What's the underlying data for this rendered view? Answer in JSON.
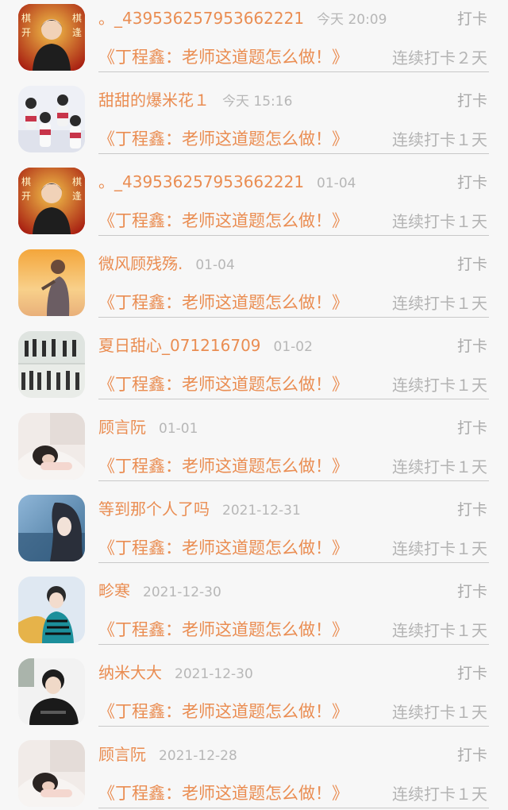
{
  "items": [
    {
      "name": "。_439536257953662221",
      "time": "今天 20:09",
      "action": "打卡",
      "title": "《丁程鑫：老师这道题怎么做！》",
      "streak": "连续打卡２天",
      "avatar": "game-poster-avatar"
    },
    {
      "name": "甜甜的爆米花１",
      "time": "今天 15:16",
      "action": "打卡",
      "title": "《丁程鑫：老师这道题怎么做！》",
      "streak": "连续打卡１天",
      "avatar": "group-photo-avatar"
    },
    {
      "name": "。_439536257953662221",
      "time": "01-04",
      "action": "打卡",
      "title": "《丁程鑫：老师这道题怎么做！》",
      "streak": "连续打卡１天",
      "avatar": "game-poster-avatar"
    },
    {
      "name": "微风顾残殇.",
      "time": "01-04",
      "action": "打卡",
      "title": "《丁程鑫：老师这道题怎么做！》",
      "streak": "连续打卡１天",
      "avatar": "sunset-girl-avatar"
    },
    {
      "name": "夏日甜心_071216709",
      "time": "01-02",
      "action": "打卡",
      "title": "《丁程鑫：老师这道题怎么做！》",
      "streak": "连续打卡１天",
      "avatar": "dance-group-avatar"
    },
    {
      "name": "顾言阮",
      "time": "01-01",
      "action": "打卡",
      "title": "《丁程鑫：老师这道题怎么做！》",
      "streak": "连续打卡１天",
      "avatar": "lying-girl-avatar"
    },
    {
      "name": "等到那个人了吗",
      "time": "2021-12-31",
      "action": "打卡",
      "title": "《丁程鑫：老师这道题怎么做！》",
      "streak": "连续打卡１天",
      "avatar": "anime-girl-avatar"
    },
    {
      "name": "畛寒",
      "time": "2021-12-30",
      "action": "打卡",
      "title": "《丁程鑫：老师这道题怎么做！》",
      "streak": "连续打卡１天",
      "avatar": "performer-avatar"
    },
    {
      "name": "纳米大大",
      "time": "2021-12-30",
      "action": "打卡",
      "title": "《丁程鑫：老师这道题怎么做！》",
      "streak": "连续打卡１天",
      "avatar": "boy-black-shirt-avatar"
    },
    {
      "name": "顾言阮",
      "time": "2021-12-28",
      "action": "打卡",
      "title": "《丁程鑫：老师这道题怎么做！》",
      "streak": "连续打卡１天",
      "avatar": "lying-girl-avatar"
    }
  ]
}
